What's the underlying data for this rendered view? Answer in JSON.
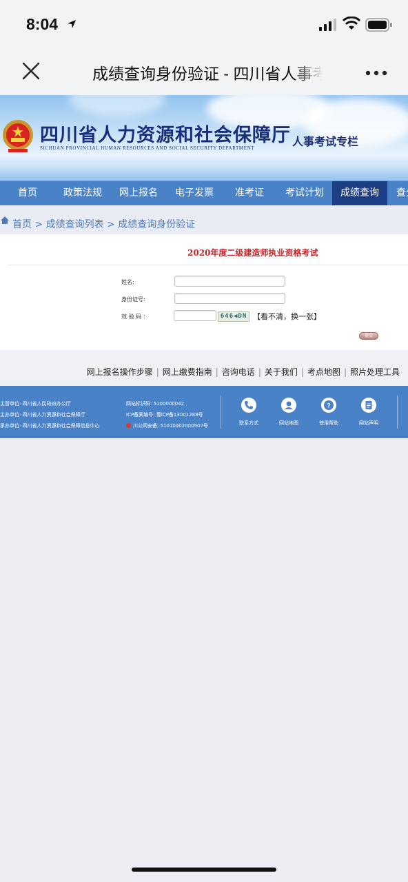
{
  "status": {
    "time": "8:04"
  },
  "nav": {
    "title": "成绩查询身份验证 - 四川省人事考试专栏"
  },
  "banner": {
    "dept_name": "四川省人力资源和社会保障厅",
    "dept_en": "SICHUAN PROVINCIAL HUMAN RESOURCES AND SOCIAL SECURITY DEPARTMENT",
    "column": "人事考试专栏"
  },
  "menu": {
    "items": [
      {
        "label": "首页"
      },
      {
        "label": "政策法规"
      },
      {
        "label": "网上报名"
      },
      {
        "label": "电子发票"
      },
      {
        "label": "准考证"
      },
      {
        "label": "考试计划"
      },
      {
        "label": "成绩查询"
      },
      {
        "label": "查分"
      }
    ]
  },
  "breadcrumb": {
    "text": "首页 > 成绩查询列表 > 成绩查询身份验证"
  },
  "form": {
    "exam_title": "2020年度二级建造师执业资格考试",
    "name_label": "姓名:",
    "id_label": "身份证号:",
    "captcha_label": "效 验 码 ：",
    "captcha_value": "646◀DN",
    "captcha_refresh": "【看不清，换一张】",
    "submit_label": "提交"
  },
  "footer_links": [
    "网上报名操作步骤",
    "网上缴费指南",
    "咨询电话",
    "关于我们",
    "考点地图",
    "照片处理工具"
  ],
  "info": {
    "sponsor": "主管单位: 四川省人民政府办公厅",
    "host": "主办单位: 四川省人力资源和社会保障厅",
    "organizer": "承办单位: 四川省人力资源和社会保障信息中心",
    "site_id": "网站标识码: 5100000042",
    "icp": "ICP备案编号: 蜀ICP备13001288号",
    "police": "川公网安备: 51010402000507号"
  },
  "footer_icons": [
    {
      "label": "联系方式",
      "icon": "phone-icon"
    },
    {
      "label": "网站地图",
      "icon": "map-icon"
    },
    {
      "label": "使用帮助",
      "icon": "help-icon"
    },
    {
      "label": "网站声明",
      "icon": "document-icon"
    }
  ],
  "colors": {
    "menu_blue": "#4a82c8",
    "active_tab": "#1c3e84",
    "exam_title_red": "#c0262b"
  }
}
